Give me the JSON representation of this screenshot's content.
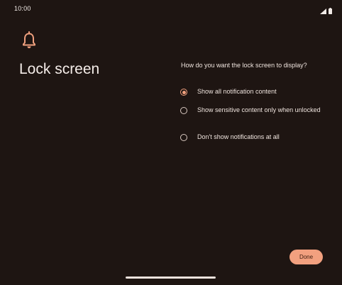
{
  "status_bar": {
    "time": "10:00",
    "icons": [
      "wifi-icon",
      "battery-icon"
    ]
  },
  "header": {
    "icon": "bell-icon",
    "title": "Lock screen"
  },
  "main": {
    "question": "How do you want the lock screen to display?",
    "options": [
      {
        "label": "Show all notification content",
        "selected": true
      },
      {
        "label": "Show sensitive content only when unlocked",
        "selected": false
      },
      {
        "label": "Don't show notifications at all",
        "selected": false
      }
    ]
  },
  "footer": {
    "done_label": "Done"
  },
  "colors": {
    "background": "#1e1512",
    "accent": "#f0a07e",
    "text": "#efe4de"
  }
}
